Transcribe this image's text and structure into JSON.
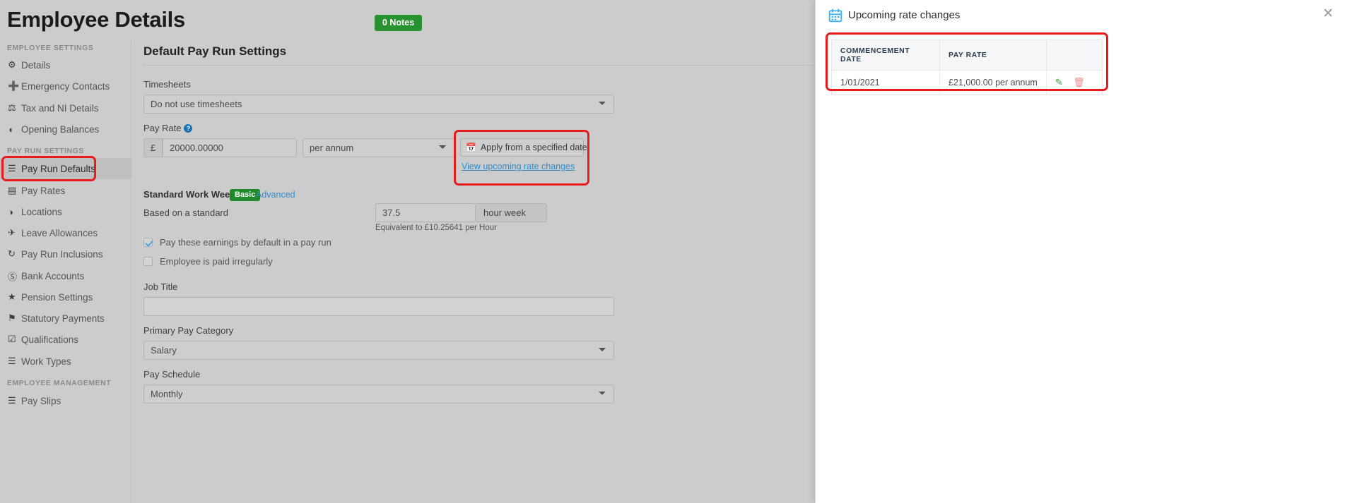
{
  "header": {
    "title": "Employee Details",
    "notes_badge": "0 Notes"
  },
  "sidebar": {
    "groups": [
      {
        "label": "EMPLOYEE SETTINGS"
      },
      {
        "label": "PAY RUN SETTINGS"
      },
      {
        "label": "EMPLOYEE MANAGEMENT"
      }
    ],
    "items": [
      {
        "label": "Details",
        "icon": "gear-icon",
        "glyph": "⚙"
      },
      {
        "label": "Emergency Contacts",
        "icon": "plus-icon",
        "glyph": "➕"
      },
      {
        "label": "Tax and NI Details",
        "icon": "scales-icon",
        "glyph": "⚖"
      },
      {
        "label": "Opening Balances",
        "icon": "leaf-icon",
        "glyph": "◖"
      },
      {
        "label": "Pay Run Defaults",
        "icon": "list-icon",
        "glyph": "☰"
      },
      {
        "label": "Pay Rates",
        "icon": "money-icon",
        "glyph": "▤"
      },
      {
        "label": "Locations",
        "icon": "globe-icon",
        "glyph": "◑"
      },
      {
        "label": "Leave Allowances",
        "icon": "plane-icon",
        "glyph": "✈"
      },
      {
        "label": "Pay Run Inclusions",
        "icon": "refresh-icon",
        "glyph": "↻"
      },
      {
        "label": "Bank Accounts",
        "icon": "dollar-circle-icon",
        "glyph": "Ⓢ"
      },
      {
        "label": "Pension Settings",
        "icon": "star-icon",
        "glyph": "★"
      },
      {
        "label": "Statutory Payments",
        "icon": "tag-icon",
        "glyph": "⚑"
      },
      {
        "label": "Qualifications",
        "icon": "checkbox-icon",
        "glyph": "☑"
      },
      {
        "label": "Work Types",
        "icon": "book-icon",
        "glyph": "☰"
      },
      {
        "label": "Pay Slips",
        "icon": "document-icon",
        "glyph": "☰"
      }
    ],
    "active": "Pay Run Defaults"
  },
  "main": {
    "section_title": "Default Pay Run Settings",
    "timesheets": {
      "label": "Timesheets",
      "value": "Do not use timesheets"
    },
    "pay_rate": {
      "label": "Pay Rate",
      "help_glyph": "?",
      "currency_symbol": "£",
      "amount": "20000.00000",
      "period": "per annum",
      "apply_button": "Apply from a specified date",
      "apply_button_icon": "calendar-icon",
      "view_link": "View upcoming rate changes"
    },
    "standard_work_week": {
      "label": "Standard Work Week",
      "basic_badge": "Basic",
      "advanced_link": "Advanced",
      "based_on_label": "Based on a standard",
      "hours_value": "37.5",
      "hours_suffix": "hour week",
      "equivalent_text": "Equivalent to £10.25641 per Hour"
    },
    "checkboxes": [
      {
        "label": "Pay these earnings by default in a pay run",
        "checked": true
      },
      {
        "label": "Employee is paid irregularly",
        "checked": false
      }
    ],
    "job_title": {
      "label": "Job Title",
      "value": "",
      "placeholder": ""
    },
    "primary_pay_category": {
      "label": "Primary Pay Category",
      "value": "Salary"
    },
    "pay_schedule": {
      "label": "Pay Schedule",
      "value": "Monthly"
    }
  },
  "drawer": {
    "icon": "calendar-icon",
    "title": "Upcoming rate changes",
    "close_glyph": "✕",
    "table": {
      "columns": [
        "COMMENCEMENT DATE",
        "PAY RATE",
        ""
      ],
      "rows": [
        {
          "commencement_date": "1/01/2021",
          "pay_rate": "£21,000.00 per annum",
          "edit_glyph": "✎",
          "delete_glyph": "Ὕ1"
        }
      ]
    }
  },
  "colors": {
    "accent_link": "#2e8bc9",
    "badge_green": "#27922f",
    "annotation_red": "#e71b1b",
    "edit_green": "#2f9e3f",
    "delete_red": "#f08b8b"
  }
}
